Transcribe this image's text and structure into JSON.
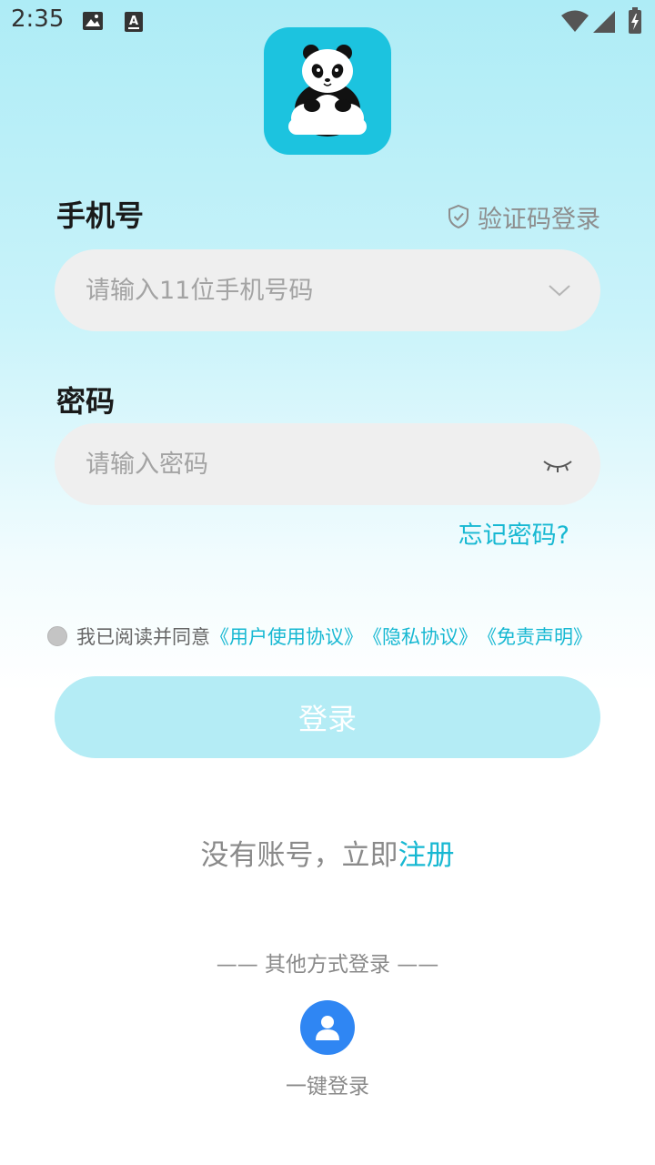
{
  "status_bar": {
    "time": "2:35",
    "icons": [
      "image-icon",
      "font-a-icon",
      "wifi-icon",
      "signal-icon",
      "battery-charging-icon"
    ]
  },
  "app": {
    "logo_icon": "panda-on-cloud-icon"
  },
  "phone": {
    "label": "手机号",
    "sms_login": "验证码登录",
    "placeholder": "请输入11位手机号码",
    "value": ""
  },
  "password": {
    "label": "密码",
    "placeholder": "请输入密码",
    "value": ""
  },
  "forgot_password": "忘记密码?",
  "agreement": {
    "text": "我已阅读并同意",
    "user_agreement": "《用户使用协议》",
    "privacy": "《隐私协议》",
    "disclaimer": "《免责声明》",
    "checked": false
  },
  "login_button": "登录",
  "register": {
    "text": "没有账号，立即",
    "link": "注册"
  },
  "other_login": {
    "title": "—— 其他方式登录 ——",
    "one_key_label": "一键登录"
  },
  "colors": {
    "accent": "#17b8d2",
    "button_disabled": "#b4ecf5",
    "input_bg": "#efefef",
    "one_key": "#2f86f3"
  }
}
